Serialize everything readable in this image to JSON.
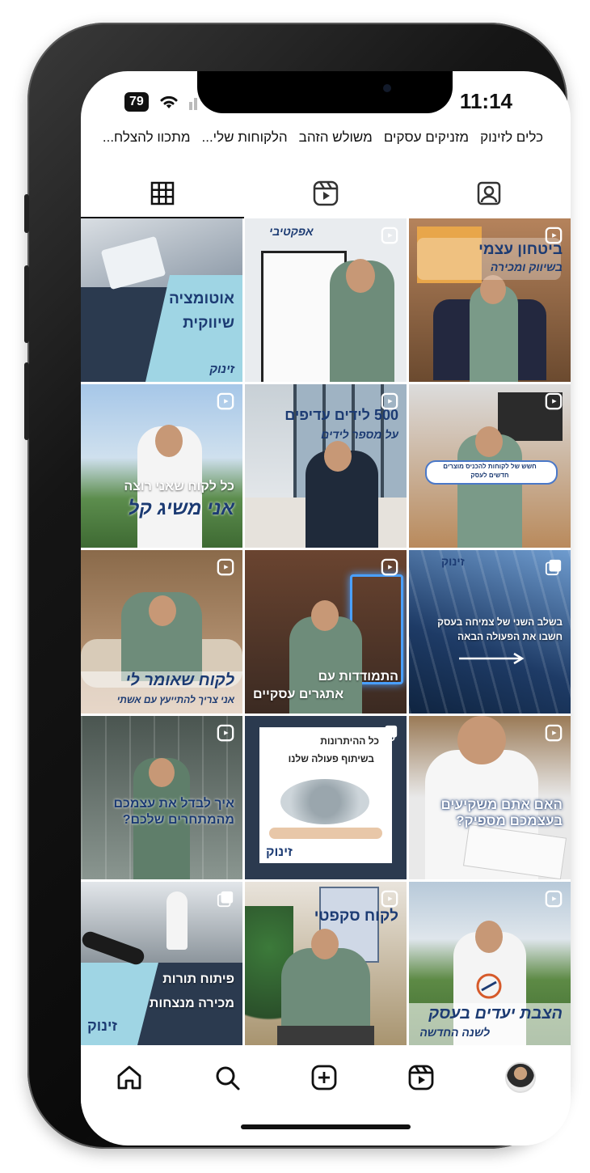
{
  "status": {
    "time": "11:14",
    "battery": "79"
  },
  "highlights": [
    "כלים לזינוק",
    "מזניקים עסקים",
    "משולש הזהב",
    "הלקוחות שלי...",
    "מתכוו להצלח..."
  ],
  "tabs": [
    {
      "icon": "grid-icon",
      "active": true
    },
    {
      "icon": "reels-icon",
      "active": false
    },
    {
      "icon": "tagged-icon",
      "active": false
    }
  ],
  "posts": [
    {
      "caption": "אוטומציה שיווקית",
      "sub": "זינוק",
      "kind": "carousel"
    },
    {
      "caption": "אפקטיבי",
      "sub": "",
      "kind": "reel"
    },
    {
      "caption": "ביטחון עצמי",
      "sub": "בשיווק ומכירה",
      "kind": "reel"
    },
    {
      "caption": "כל לקוח שאני רוצה",
      "sub": "אני משיג קל",
      "kind": "reel"
    },
    {
      "caption": "500 לידים עדיפים",
      "sub": "על מספר לידים",
      "kind": "reel"
    },
    {
      "caption": "חשש של לקוחות להכניס מוצרים חדשים לעסק",
      "sub": "",
      "kind": "reel"
    },
    {
      "caption": "לקוח שאומר לי",
      "sub": "אני צריך להתייעץ עם אשתי",
      "kind": "reel"
    },
    {
      "caption": "התמודדות עם",
      "sub": "אתגרים עסקיים",
      "kind": "reel"
    },
    {
      "caption": "בשלב השני של צמיחה בעסק",
      "sub": "חשבו את הפעולה הבאה",
      "kind": "carousel"
    },
    {
      "caption": "איך לבדל את עצמכם",
      "sub": "מהמתחרים שלכם?",
      "kind": "reel"
    },
    {
      "caption": "כל ההיתרונות",
      "sub": "בשיתוף פעולה שלנו",
      "kind": "carousel"
    },
    {
      "caption": "האם אתם משקיעים",
      "sub": "בעצמכם מספיק?",
      "kind": "reel"
    },
    {
      "caption": "פיתוח תורות",
      "sub": "מכירה מנצחות",
      "kind": "carousel"
    },
    {
      "caption": "לקוח סקפטי",
      "sub": "",
      "kind": "reel"
    },
    {
      "caption": "הצבת יעדים בעסק",
      "sub": "לשנה החדשה",
      "kind": "reel"
    }
  ],
  "bottom_nav": [
    "home-icon",
    "search-icon",
    "create-icon",
    "reels-icon",
    "profile-avatar"
  ]
}
